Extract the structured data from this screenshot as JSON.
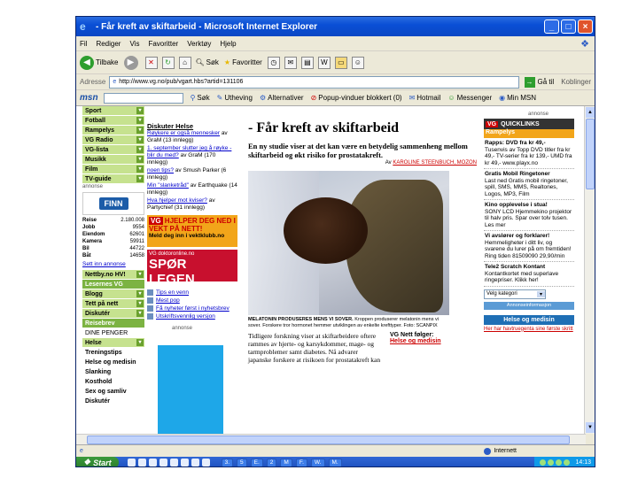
{
  "window": {
    "title": "- Får kreft av skiftarbeid - Microsoft Internet Explorer"
  },
  "menu": [
    "Fil",
    "Rediger",
    "Vis",
    "Favoritter",
    "Verktøy",
    "Hjelp"
  ],
  "toolbar": {
    "back": "Tilbake",
    "search": "Søk",
    "favorites": "Favoritter"
  },
  "address": {
    "label": "Adresse",
    "url": "http://www.vg.no/pub/vgart.hbs?artid=131106",
    "go": "Gå til",
    "links": "Koblinger"
  },
  "msn": {
    "brand": "msn",
    "items": [
      "Søk",
      "Utheving",
      "Alternativer",
      "Popup-vinduer blokkert (0)",
      "Hotmail",
      "Messenger",
      "Min MSN"
    ]
  },
  "left_nav": {
    "items": [
      {
        "label": "Sport",
        "style": "green"
      },
      {
        "label": "Fotball",
        "style": "green"
      },
      {
        "label": "Rampelys",
        "style": "green"
      },
      {
        "label": "VG Radio",
        "style": "green"
      },
      {
        "label": "VG-lista",
        "style": "green"
      },
      {
        "label": "Musikk",
        "style": "green"
      },
      {
        "label": "Film",
        "style": "green"
      },
      {
        "label": "TV-guide",
        "style": "green"
      }
    ],
    "annonse": "annonse",
    "finn": "FINN",
    "finn_rows": [
      {
        "label": "Reise",
        "value": "2.180.008"
      },
      {
        "label": "Jobb",
        "value": "9554"
      },
      {
        "label": "Eiendom",
        "value": "62601"
      },
      {
        "label": "Kamera",
        "value": "59911"
      },
      {
        "label": "Bil",
        "value": "44722"
      },
      {
        "label": "Båt",
        "value": "14658"
      }
    ],
    "finn_link": "Sett inn annonse",
    "items2": [
      {
        "label": "Nettby.no HV!",
        "style": "green"
      },
      {
        "label": "Lesernes VG",
        "style": "dgreen"
      },
      {
        "label": "Blogg",
        "style": "green"
      },
      {
        "label": "Tett på nett",
        "style": "green"
      },
      {
        "label": "Diskutér",
        "style": "green"
      },
      {
        "label": "Reisebrev",
        "style": "dgreen"
      },
      {
        "label": "DINE PENGER",
        "style": "white"
      },
      {
        "label": "Helse",
        "style": "green"
      }
    ],
    "helse_links": [
      "Treningstips",
      "Helse og medisin",
      "Slanking",
      "Kosthold",
      "Sex og samliv",
      "Diskutér"
    ]
  },
  "discuss": {
    "title": "Diskuter Helse",
    "items": [
      {
        "link": "Røykere er også mennesker",
        "meta": " av GraM (13 innlegg)"
      },
      {
        "link": "1. september slutter jeg å røyke - blir du med?",
        "meta": " av GraM (170 innlegg)"
      },
      {
        "link": "noen tips?",
        "meta": " av Smush Parker (6 innlegg)"
      },
      {
        "link": "Min \"slanketråd\"",
        "meta": " av Earthquake (14 innlegg)"
      },
      {
        "link": "Hva hjelper mot kviser?",
        "meta": " av Partychief (31 innlegg)"
      }
    ],
    "banner1_vg": "VG",
    "banner1_text": "HJELPER DEG NED I VEKT PÅ NETT!",
    "banner1_sub": "Meld deg inn i vektklubb.no",
    "banner2_small": "VG doktoronline.no",
    "banner2_text": "SPØR LEGEN",
    "tools": [
      "Tips en venn",
      "Mest pop",
      "Få nyheter først i nyhetsbrev",
      "Utskriftsvennlig versjon"
    ],
    "annonse": "annonse"
  },
  "article": {
    "headline": "- Får kreft av skiftarbeid",
    "ingress": "En ny studie viser at det kan være en betydelig sammenheng mellom skiftarbeid og økt risiko for prostatakreft.",
    "byline_prefix": "Av ",
    "byline": "KAROLINE STEENBUCH, MOZON",
    "caption_bold": "MELATONIN PRODUSERES MENS VI SOVER.",
    "caption": " Kroppen produserer melatonin mens vi sover. Forskere tror hormonet hemmer utviklingen av enkelte krefttyper. Foto: SCANPIX",
    "body": "Tidligere forskning viser at skiftarbeidere oftere rammes av hjerte- og karsykdommer, mage- og tarmproblemer samt diabetes. Nå advarer japanske forskere at risikoen for prostatakreft kan",
    "follow_title": "VG Nett følger:",
    "follow_link": "Helse og medisin"
  },
  "right": {
    "annonse": "annonse",
    "head_vg": "VG",
    "head": "QUICKLINKS",
    "rampe": "Rampelys",
    "items": [
      {
        "title": "Rapps: DVD fra kr 49,-",
        "text": "Tusenvis av Topp DVD titler fra kr 49,- TV-serier fra kr 139,- UMD fra kr 49,- www.playx.no"
      },
      {
        "title": "Gratis Mobil Ringetoner",
        "text": "Last ned Gratis mobil ringetoner, spill, SMS, MMS, Realtones, Logos, MP3, Film"
      },
      {
        "title": "Kino opplevelse i stua!",
        "text": "SONY LCD Hjemmekino projektor til halv pris. Spar over tolv tusen. Les mer"
      },
      {
        "title": "Vi avslører og forklarer!",
        "text": "Hemmeligheter i ditt liv, og svarene du lurer på om fremtiden! Ring tiden 81509090 29,90/min"
      },
      {
        "title": "Tele2 Scratch Kontant",
        "text": "Kontantkortet med superlave ringepriser. Klikk her!"
      }
    ],
    "select": "Velg kategori",
    "blue": "Annonseinformasjon",
    "helse": "Helse og medisin",
    "helse_link": "Her har havtruegenta sine første skritt"
  },
  "status": {
    "zone": "Internett"
  },
  "taskbar": {
    "start": "Start",
    "tasks": [
      "3.",
      "5",
      "E.",
      "2",
      "M",
      "F.",
      "W.",
      "M."
    ],
    "clock": "14:13"
  }
}
